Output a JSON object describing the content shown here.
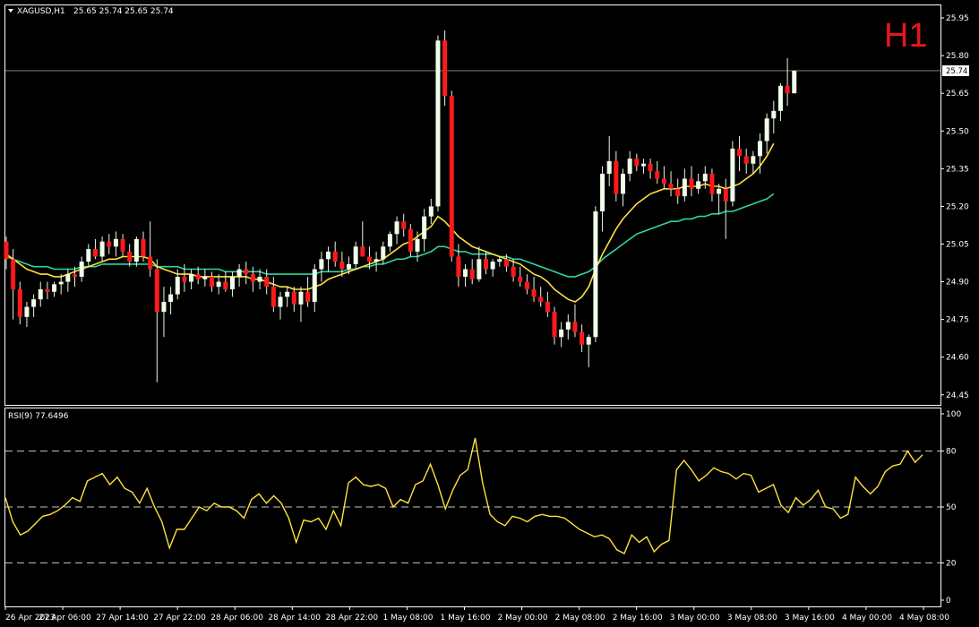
{
  "chart_data": {
    "type": "candlestick",
    "symbol_label": "XAGUSD,H1",
    "ohlc_label": "25.65 25.74 25.65 25.74",
    "timeframe_label": "H1",
    "current_price_label": "25.74",
    "current_price": 25.74,
    "ylim": [
      24.41,
      26.0
    ],
    "y_ticks": [
      "25.95",
      "25.80",
      "25.65",
      "25.50",
      "25.35",
      "25.20",
      "25.05",
      "24.90",
      "24.75",
      "24.60",
      "24.45"
    ],
    "x_labels": [
      "26 Apr 2023",
      "27 Apr 06:00",
      "27 Apr 14:00",
      "27 Apr 22:00",
      "28 Apr 06:00",
      "28 Apr 14:00",
      "28 Apr 22:00",
      "1 May 08:00",
      "1 May 16:00",
      "2 May 00:00",
      "2 May 08:00",
      "2 May 16:00",
      "3 May 00:00",
      "3 May 08:00",
      "3 May 16:00",
      "4 May 00:00",
      "4 May 08:00"
    ],
    "candles": [
      [
        25.06,
        25.08,
        24.95,
        24.99
      ],
      [
        24.99,
        25.03,
        24.75,
        24.87
      ],
      [
        24.87,
        24.9,
        24.73,
        24.76
      ],
      [
        24.76,
        24.82,
        24.72,
        24.8
      ],
      [
        24.8,
        24.85,
        24.76,
        24.83
      ],
      [
        24.83,
        24.9,
        24.8,
        24.87
      ],
      [
        24.87,
        24.9,
        24.83,
        24.86
      ],
      [
        24.86,
        24.9,
        24.84,
        24.89
      ],
      [
        24.89,
        24.93,
        24.85,
        24.9
      ],
      [
        24.9,
        24.95,
        24.86,
        24.93
      ],
      [
        24.93,
        24.96,
        24.88,
        24.92
      ],
      [
        24.92,
        25.0,
        24.9,
        24.98
      ],
      [
        24.98,
        25.05,
        24.96,
        25.03
      ],
      [
        25.03,
        25.07,
        24.99,
        25.0
      ],
      [
        25.0,
        25.08,
        24.98,
        25.06
      ],
      [
        25.06,
        25.09,
        25.01,
        25.04
      ],
      [
        25.04,
        25.1,
        25.0,
        25.07
      ],
      [
        25.07,
        25.09,
        25.0,
        25.02
      ],
      [
        25.02,
        25.05,
        24.96,
        24.98
      ],
      [
        24.98,
        25.08,
        24.96,
        25.07
      ],
      [
        25.07,
        25.1,
        24.98,
        25.0
      ],
      [
        25.0,
        25.14,
        24.92,
        24.95
      ],
      [
        24.95,
        24.99,
        24.5,
        24.78
      ],
      [
        24.78,
        24.88,
        24.68,
        24.82
      ],
      [
        24.82,
        24.88,
        24.77,
        24.85
      ],
      [
        24.85,
        24.95,
        24.83,
        24.92
      ],
      [
        24.92,
        24.97,
        24.86,
        24.9
      ],
      [
        24.9,
        24.95,
        24.87,
        24.93
      ],
      [
        24.93,
        24.96,
        24.89,
        24.91
      ],
      [
        24.91,
        24.95,
        24.88,
        24.92
      ],
      [
        24.92,
        24.94,
        24.86,
        24.88
      ],
      [
        24.88,
        24.93,
        24.85,
        24.9
      ],
      [
        24.9,
        24.94,
        24.86,
        24.87
      ],
      [
        24.87,
        24.94,
        24.84,
        24.92
      ],
      [
        24.92,
        24.97,
        24.88,
        24.95
      ],
      [
        24.95,
        24.98,
        24.89,
        24.93
      ],
      [
        24.93,
        24.96,
        24.86,
        24.9
      ],
      [
        24.9,
        24.95,
        24.87,
        24.92
      ],
      [
        24.92,
        24.95,
        24.85,
        24.88
      ],
      [
        24.88,
        24.92,
        24.78,
        24.8
      ],
      [
        24.8,
        24.86,
        24.75,
        24.84
      ],
      [
        24.84,
        24.88,
        24.8,
        24.86
      ],
      [
        24.86,
        24.88,
        24.78,
        24.81
      ],
      [
        24.81,
        24.88,
        24.74,
        24.86
      ],
      [
        24.86,
        24.92,
        24.8,
        24.82
      ],
      [
        24.82,
        24.97,
        24.78,
        24.95
      ],
      [
        24.95,
        25.02,
        24.9,
        24.99
      ],
      [
        24.99,
        25.04,
        24.94,
        25.02
      ],
      [
        25.02,
        25.06,
        24.96,
        24.98
      ],
      [
        24.98,
        25.02,
        24.92,
        24.95
      ],
      [
        24.95,
        25.0,
        24.93,
        24.97
      ],
      [
        24.97,
        25.06,
        24.95,
        25.04
      ],
      [
        25.04,
        25.14,
        25.02,
        25.0
      ],
      [
        25.0,
        25.04,
        24.95,
        24.98
      ],
      [
        24.98,
        25.02,
        24.94,
        24.99
      ],
      [
        24.99,
        25.06,
        24.97,
        25.04
      ],
      [
        25.04,
        25.1,
        25.02,
        25.09
      ],
      [
        25.09,
        25.16,
        25.05,
        25.14
      ],
      [
        25.14,
        25.17,
        25.08,
        25.11
      ],
      [
        25.11,
        25.13,
        25.0,
        25.02
      ],
      [
        25.02,
        25.1,
        24.98,
        25.07
      ],
      [
        25.07,
        25.19,
        25.02,
        25.16
      ],
      [
        25.16,
        25.23,
        25.13,
        25.2
      ],
      [
        25.2,
        25.88,
        25.18,
        25.86
      ],
      [
        25.86,
        25.9,
        25.6,
        25.64
      ],
      [
        25.64,
        25.66,
        24.98,
        25.0
      ],
      [
        25.0,
        25.05,
        24.88,
        24.92
      ],
      [
        24.92,
        24.97,
        24.88,
        24.95
      ],
      [
        24.95,
        24.99,
        24.89,
        24.91
      ],
      [
        24.91,
        25.04,
        24.9,
        24.99
      ],
      [
        24.99,
        25.02,
        24.93,
        24.95
      ],
      [
        24.95,
        24.99,
        24.92,
        24.98
      ],
      [
        24.98,
        25.0,
        24.96,
        24.99
      ],
      [
        24.99,
        25.01,
        24.94,
        24.96
      ],
      [
        24.96,
        24.99,
        24.9,
        24.92
      ],
      [
        24.92,
        24.96,
        24.88,
        24.9
      ],
      [
        24.9,
        24.93,
        24.85,
        24.87
      ],
      [
        24.87,
        24.92,
        24.82,
        24.84
      ],
      [
        24.84,
        24.88,
        24.8,
        24.82
      ],
      [
        24.82,
        24.86,
        24.76,
        24.78
      ],
      [
        24.78,
        24.8,
        24.65,
        24.68
      ],
      [
        24.68,
        24.74,
        24.64,
        24.71
      ],
      [
        24.71,
        24.77,
        24.67,
        24.74
      ],
      [
        24.74,
        24.81,
        24.68,
        24.7
      ],
      [
        24.7,
        24.73,
        24.62,
        24.65
      ],
      [
        24.65,
        24.69,
        24.56,
        24.68
      ],
      [
        24.68,
        25.2,
        24.66,
        25.18
      ],
      [
        25.18,
        25.36,
        25.1,
        25.33
      ],
      [
        25.33,
        25.48,
        25.28,
        25.38
      ],
      [
        25.38,
        25.42,
        25.22,
        25.25
      ],
      [
        25.25,
        25.35,
        25.2,
        25.33
      ],
      [
        25.33,
        25.42,
        25.3,
        25.39
      ],
      [
        25.39,
        25.41,
        25.34,
        25.36
      ],
      [
        25.36,
        25.39,
        25.33,
        25.37
      ],
      [
        25.37,
        25.39,
        25.31,
        25.34
      ],
      [
        25.34,
        25.38,
        25.29,
        25.31
      ],
      [
        25.31,
        25.36,
        25.27,
        25.29
      ],
      [
        25.29,
        25.34,
        25.24,
        25.27
      ],
      [
        25.27,
        25.31,
        25.21,
        25.24
      ],
      [
        25.24,
        25.35,
        25.22,
        25.31
      ],
      [
        25.31,
        25.36,
        25.24,
        25.27
      ],
      [
        25.27,
        25.33,
        25.25,
        25.3
      ],
      [
        25.3,
        25.36,
        25.27,
        25.33
      ],
      [
        25.33,
        25.35,
        25.22,
        25.25
      ],
      [
        25.25,
        25.29,
        25.17,
        25.27
      ],
      [
        25.27,
        25.31,
        25.07,
        25.22
      ],
      [
        25.22,
        25.46,
        25.2,
        25.43
      ],
      [
        25.43,
        25.48,
        25.34,
        25.4
      ],
      [
        25.4,
        25.43,
        25.33,
        25.37
      ],
      [
        25.37,
        25.42,
        25.33,
        25.4
      ],
      [
        25.4,
        25.49,
        25.33,
        25.46
      ],
      [
        25.46,
        25.57,
        25.41,
        25.55
      ],
      [
        25.55,
        25.62,
        25.49,
        25.58
      ],
      [
        25.58,
        25.69,
        25.54,
        25.68
      ],
      [
        25.68,
        25.79,
        25.6,
        25.65
      ],
      [
        25.65,
        25.74,
        25.65,
        25.74
      ]
    ],
    "ma_slow": [
      25.0,
      24.99,
      24.98,
      24.97,
      24.96,
      24.96,
      24.96,
      24.95,
      24.95,
      24.95,
      24.95,
      24.96,
      24.96,
      24.96,
      24.97,
      24.97,
      24.97,
      24.97,
      24.97,
      24.97,
      24.97,
      24.97,
      24.96,
      24.96,
      24.96,
      24.96,
      24.95,
      24.95,
      24.95,
      24.95,
      24.95,
      24.95,
      24.94,
      24.94,
      24.94,
      24.94,
      24.94,
      24.94,
      24.93,
      24.93,
      24.93,
      24.93,
      24.93,
      24.93,
      24.93,
      24.93,
      24.94,
      24.94,
      24.94,
      24.94,
      24.95,
      24.95,
      24.96,
      24.96,
      24.97,
      24.97,
      24.98,
      24.99,
      24.99,
      25.0,
      25.0,
      25.01,
      25.02,
      25.04,
      25.04,
      25.03,
      25.02,
      25.02,
      25.01,
      25.01,
      25.01,
      25.01,
      25.0,
      25.0,
      24.99,
      24.99,
      24.98,
      24.97,
      24.96,
      24.95,
      24.94,
      24.93,
      24.92,
      24.92,
      24.93,
      24.94,
      24.96,
      24.99,
      25.01,
      25.03,
      25.05,
      25.07,
      25.09,
      25.1,
      25.11,
      25.12,
      25.13,
      25.14,
      25.14,
      25.15,
      25.15,
      25.16,
      25.16,
      25.17,
      25.17,
      25.18,
      25.18,
      25.19,
      25.2,
      25.21,
      25.22,
      25.23,
      25.25
    ],
    "ma_fast": [
      25.01,
      24.99,
      24.97,
      24.95,
      24.94,
      24.93,
      24.93,
      24.92,
      24.92,
      24.93,
      24.94,
      24.95,
      24.96,
      24.97,
      24.98,
      24.99,
      24.99,
      25.0,
      25.0,
      25.0,
      25.0,
      24.99,
      24.96,
      24.95,
      24.94,
      24.93,
      24.93,
      24.93,
      24.92,
      24.92,
      24.92,
      24.92,
      24.92,
      24.92,
      24.92,
      24.92,
      24.91,
      24.91,
      24.9,
      24.89,
      24.88,
      24.88,
      24.87,
      24.87,
      24.87,
      24.88,
      24.89,
      24.91,
      24.92,
      24.93,
      24.94,
      24.95,
      24.96,
      24.97,
      24.98,
      24.99,
      25.01,
      25.03,
      25.05,
      25.06,
      25.08,
      25.1,
      25.12,
      25.16,
      25.14,
      25.11,
      25.08,
      25.06,
      25.04,
      25.03,
      25.02,
      25.01,
      25.0,
      24.99,
      24.98,
      24.97,
      24.95,
      24.93,
      24.92,
      24.9,
      24.87,
      24.85,
      24.83,
      24.82,
      24.84,
      24.88,
      24.95,
      25.01,
      25.06,
      25.11,
      25.15,
      25.18,
      25.21,
      25.23,
      25.25,
      25.26,
      25.27,
      25.27,
      25.27,
      25.28,
      25.28,
      25.28,
      25.29,
      25.28,
      25.28,
      25.27,
      25.28,
      25.29,
      25.31,
      25.33,
      25.36,
      25.4,
      25.45
    ],
    "rsi": {
      "label": "RSI(9) 77.6496",
      "ylim": [
        0,
        100
      ],
      "y_ticks": [
        "100",
        "80",
        "50",
        "20",
        "0"
      ],
      "levels": [
        80,
        50,
        20
      ],
      "values": [
        55,
        42,
        35,
        37,
        41,
        45,
        46,
        48,
        51,
        55,
        53,
        64,
        66,
        68,
        62,
        66,
        60,
        58,
        52,
        60,
        50,
        42,
        28,
        38,
        38,
        44,
        50,
        48,
        52,
        50,
        50,
        48,
        44,
        54,
        57,
        52,
        56,
        52,
        44,
        31,
        43,
        42,
        44,
        38,
        48,
        40,
        63,
        66,
        62,
        61,
        62,
        60,
        50,
        54,
        52,
        62,
        64,
        73,
        62,
        49,
        59,
        67,
        70,
        87,
        63,
        46,
        42,
        40,
        45,
        44,
        42,
        45,
        46,
        45,
        45,
        44,
        41,
        38,
        36,
        34,
        35,
        33,
        27,
        25,
        35,
        31,
        34,
        26,
        30,
        32,
        70,
        75,
        70,
        64,
        67,
        71,
        69,
        68,
        65,
        68,
        67,
        58,
        60,
        62,
        51,
        47,
        55,
        51,
        54,
        59,
        50,
        49,
        44,
        46,
        66,
        61,
        57,
        61,
        69,
        72,
        73,
        80,
        74,
        78
      ]
    }
  }
}
